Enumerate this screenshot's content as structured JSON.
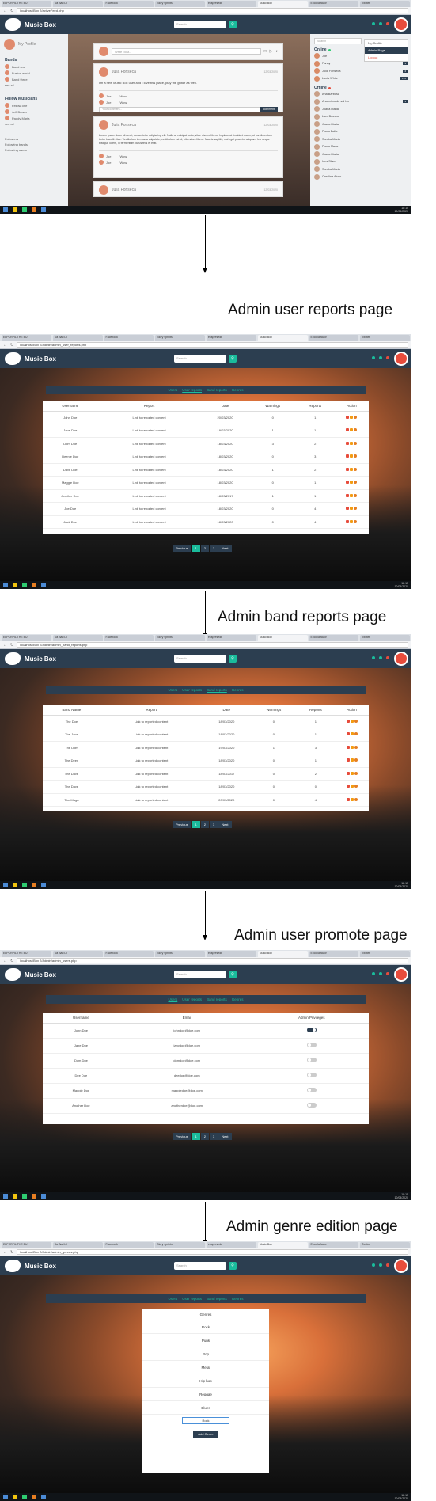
{
  "browser": {
    "tabs": [
      "ELPCRPIL THE BU",
      "Da Bad Lil",
      "Facebook",
      "Story sprints",
      "ekspresede",
      "Music Box",
      "Ecco la favor",
      "Twitter"
    ],
    "urls": [
      "localhost/Box 2/activeFeed.php",
      "localhost/Box 2/Admin/admin_user_reports.php",
      "localhost/Box 2/Admin/admin_band_reports.php",
      "localhost/Box 2/Admin/admin_users.php",
      "localhost/Box 2/Admin/admin_genres.php"
    ]
  },
  "app": {
    "brand": "Music Box",
    "search_placeholder": "Search"
  },
  "taskbar": {
    "time": "18:15",
    "date": "10/03/2020",
    "lang": "ENG"
  },
  "captions": {
    "user_reports": "Admin user reports  page",
    "band_reports": "Admin band reports  page",
    "user_promote": "Admin user promote page",
    "genre_edition": "Admin genre edition page"
  },
  "admin_tabs": [
    "Users",
    "User reports",
    "Band reports",
    "Genres"
  ],
  "feed": {
    "my_profile": "My Profile",
    "left_sections": [
      {
        "title": "Bands",
        "items": [
          "Band one",
          "Fusion world",
          "Band three"
        ],
        "more": "see all"
      },
      {
        "title": "Fellow Musicians",
        "items": [
          "Fellow one",
          "Jeff Brown",
          "Paddy Maria"
        ],
        "more": "see all"
      }
    ],
    "left_links": [
      "Followers",
      "Following bands",
      "Following users"
    ],
    "post_placeholder": "Write post...",
    "posts": [
      {
        "author": "Julia Fonseca",
        "date": "12/03/2020",
        "text": "I'm a new Music Box user and I love this place, play the guitar as well.",
        "comments": [
          {
            "name": "Joe",
            "text": "Wow"
          },
          {
            "name": "Joe",
            "text": "Wow"
          }
        ],
        "comment_placeholder": "Your comment...",
        "comment_button": "comment"
      },
      {
        "author": "Julia Fonseca",
        "date": "12/03/2020",
        "text": "Lorem ipsum dolor sit amet, consectetur adipiscing elit. Nulla at volutpat justo, vitae viverra libero. In placerat tincidunt quam, ut condimentum tortor blandit vitae. Vestibulum in massa vulputate, vestibulum est id, bibendum libero. Mauris sagittis, nisl eget pharetra aliquam, leo neque tristique lorem, in fermentum purus felis et erat.",
        "comments": [
          {
            "name": "Joe",
            "text": "Wow"
          },
          {
            "name": "Joe",
            "text": "Wow"
          }
        ]
      },
      {
        "author": "Julia Fonseca",
        "date": "12/03/2020"
      }
    ],
    "online_title": "Online",
    "online": [
      {
        "name": "Joe",
        "count": "1"
      },
      {
        "name": "Fanny",
        "count": "3"
      },
      {
        "name": "Julia Fonseca",
        "count": "4"
      },
      {
        "name": "Lucia White",
        "count": "172"
      }
    ],
    "offline_title": "Offline",
    "offline": [
      "Ana Barbosa",
      "Ana mimo de sol ba",
      "Joana Maria",
      "Lara Branca",
      "Joana Maria",
      "Paula Balta",
      "Sandra Maria",
      "Paula Maria",
      "Joana Maria",
      "Ines Silva",
      "Sandra Maria",
      "Carolina Alves"
    ],
    "offline_counts": {
      "1": "3"
    },
    "dropdown": [
      "My Profile",
      "Admin Page",
      "Logout"
    ]
  },
  "user_reports": {
    "headers": [
      "Username",
      "Report",
      "Date",
      "Warnings",
      "Reports",
      "Action"
    ],
    "rows": [
      [
        "John Doe",
        "Link to reported content",
        "20/03/2020",
        "0",
        "1"
      ],
      [
        "Jane Doe",
        "Link to reported content",
        "19/03/2020",
        "1",
        "1"
      ],
      [
        "Dom Doe",
        "Link to reported content",
        "18/03/2020",
        "3",
        "2"
      ],
      [
        "Deenie Doe",
        "Link to reported content",
        "18/03/2020",
        "0",
        "3"
      ],
      [
        "Dave Doe",
        "Link to reported content",
        "18/03/2020",
        "1",
        "2"
      ],
      [
        "Maggie Doe",
        "Link to reported content",
        "18/03/2020",
        "0",
        "1"
      ],
      [
        "Another Doe",
        "Link to reported content",
        "18/03/2017",
        "1",
        "1"
      ],
      [
        "Joe Doe",
        "Link to reported content",
        "18/03/2020",
        "0",
        "4"
      ],
      [
        "Jack Doe",
        "Link to reported content",
        "18/03/2020",
        "0",
        "4"
      ]
    ],
    "pager": [
      "Previous",
      "1",
      "2",
      "3",
      "Next"
    ]
  },
  "band_reports": {
    "headers": [
      "Band Name",
      "Report",
      "Date",
      "Warnings",
      "Reports",
      "Action"
    ],
    "rows": [
      [
        "The Doe",
        "Link to reported content",
        "18/03/2020",
        "0",
        "1"
      ],
      [
        "The Jane",
        "Link to reported content",
        "18/03/2020",
        "0",
        "1"
      ],
      [
        "The Dom",
        "Link to reported content",
        "19/03/2020",
        "1",
        "3"
      ],
      [
        "The Deen",
        "Link to reported content",
        "18/03/2020",
        "0",
        "1"
      ],
      [
        "The Dave",
        "Link to reported content",
        "18/03/2017",
        "0",
        "2"
      ],
      [
        "The Dave",
        "Link to reported content",
        "18/03/2020",
        "0",
        "0"
      ],
      [
        "The Maga",
        "Link to reported content",
        "20/03/2020",
        "0",
        "4"
      ]
    ],
    "pager": [
      "Previous",
      "1",
      "2",
      "3",
      "Next"
    ]
  },
  "user_promote": {
    "headers": [
      "Username",
      "Email",
      "Admin Privileges"
    ],
    "rows": [
      {
        "username": "John Doe",
        "email": "johndoe@doe.com",
        "admin": true
      },
      {
        "username": "Jane Doe",
        "email": "janydoe@doe.com",
        "admin": false
      },
      {
        "username": "Dom Doe",
        "email": "domdoe@doe.com",
        "admin": false
      },
      {
        "username": "Dee Doe",
        "email": "deedoe@doe.com",
        "admin": false
      },
      {
        "username": "Maggie Doe",
        "email": "maggiedoe@doe.com",
        "admin": false
      },
      {
        "username": "Another Doe",
        "email": "anotherdoe@doe.com",
        "admin": false
      }
    ],
    "pager": [
      "Previous",
      "1",
      "2",
      "3",
      "Next"
    ]
  },
  "genres": {
    "header": "Genres",
    "items": [
      "Rock",
      "Punk",
      "Pop",
      "Metal",
      "Hip hop",
      "Reggae",
      "Blues"
    ],
    "new_value": "Rock",
    "button": "Add Genre"
  }
}
